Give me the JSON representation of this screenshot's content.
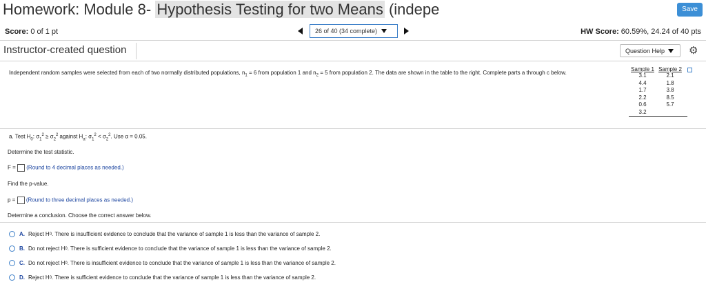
{
  "header": {
    "title_prefix": "Homework: Module 8- ",
    "title_highlight": "Hypothesis Testing for two Means",
    "title_suffix": " (indepe",
    "save_label": "Save"
  },
  "score": {
    "label": "Score:",
    "value": "0 of 1 pt"
  },
  "nav": {
    "current": "26 of 40 (34 complete)"
  },
  "hw_score": {
    "label": "HW Score:",
    "value": "60.59%, 24.24 of 40 pts"
  },
  "question": {
    "type_label": "Instructor-created question",
    "help_label": "Question Help",
    "intro_a": "Independent random samples were selected from each of two normally distributed populations, n",
    "n1_sub": "1",
    "intro_b": " = 6 from population 1 and n",
    "n2_sub": "2",
    "intro_c": " = 5 from population 2. The data are shown in the table to the right. Complete parts a through c below."
  },
  "table": {
    "headers": [
      "Sample 1",
      "Sample 2"
    ],
    "rows": [
      [
        "3.1",
        "2.1"
      ],
      [
        "4.4",
        "1.8"
      ],
      [
        "1.7",
        "3.8"
      ],
      [
        "2.2",
        "8.5"
      ],
      [
        "0.6",
        "5.7"
      ],
      [
        "3.2",
        ""
      ]
    ]
  },
  "part_a": {
    "prefix": "a. Test H",
    "h0_sub": "0",
    "h0_rel": ": σ",
    "s1_sub": "1",
    "s1_sup": "2",
    "ge": " ≥ σ",
    "s2_sub": "2",
    "s2_sup": "2",
    "against": " against H",
    "ha_sub": "a",
    "ha_rel": ": σ",
    "s1b_sub": "1",
    "s1b_sup": "2",
    "lt": " < σ",
    "s2b_sub": "2",
    "s2b_sup": "2",
    "alpha": ". Use α = 0.05."
  },
  "steps": {
    "test_stat": "Determine the test statistic.",
    "f_label": "F =",
    "f_hint": "(Round to 4 decimal places as needed.)",
    "pvalue": "Find the p-value.",
    "p_label": "p =",
    "p_hint": "(Round to three decimal places as needed.)",
    "conclusion": "Determine a conclusion. Choose the correct answer below."
  },
  "options": [
    {
      "letter": "A.",
      "pre": "Reject H",
      "sub": "0",
      "post": ". There is insufficient evidence to conclude that the variance of sample 1 is less than the variance of sample 2."
    },
    {
      "letter": "B.",
      "pre": "Do not reject H",
      "sub": "0",
      "post": ". There is sufficient evidence to conclude that the variance of sample 1 is less than the variance of sample 2."
    },
    {
      "letter": "C.",
      "pre": "Do not reject H",
      "sub": "0",
      "post": ". There is insufficient evidence to conclude that the variance of sample 1 is less than the variance of sample 2."
    },
    {
      "letter": "D.",
      "pre": "Reject H",
      "sub": "0",
      "post": ". There is sufficient evidence to conclude that the variance of sample 1 is less than the variance of sample 2."
    }
  ],
  "colors": {
    "accent": "#3c8fd6",
    "link": "#1d46a0"
  }
}
